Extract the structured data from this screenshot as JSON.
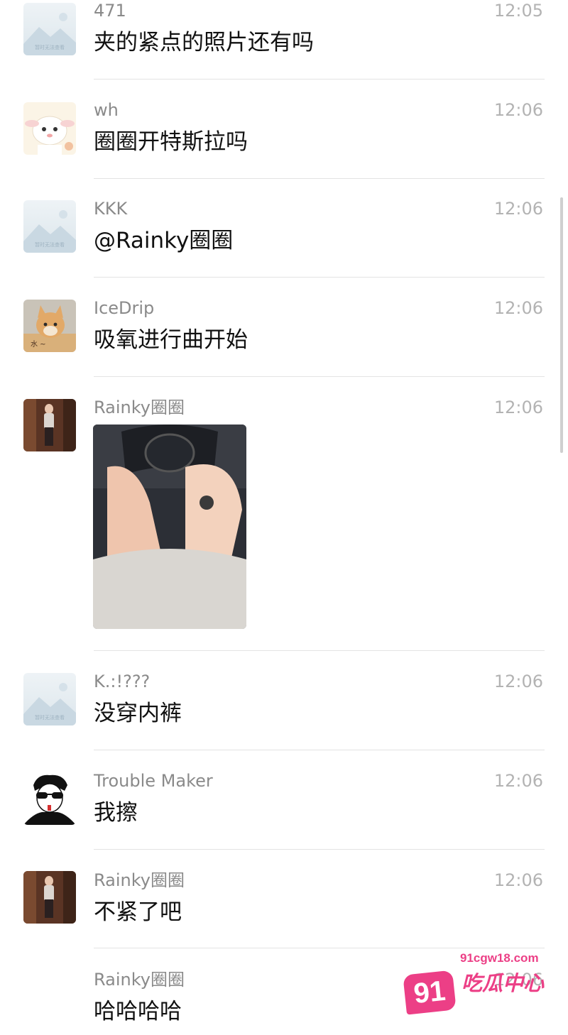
{
  "messages": [
    {
      "sender": "471",
      "time": "12:05",
      "text": "夹的紧点的照片还有吗",
      "avatar": "placeholder-image-icon"
    },
    {
      "sender": "wh",
      "time": "12:06",
      "text": "圈圈开特斯拉吗",
      "avatar": "lamb-cartoon-avatar"
    },
    {
      "sender": "KKK",
      "time": "12:06",
      "text": "@Rainky圈圈",
      "avatar": "placeholder-image-icon"
    },
    {
      "sender": "IceDrip",
      "time": "12:06",
      "text": "吸氧进行曲开始",
      "avatar": "cat-photo-avatar"
    },
    {
      "sender": "Rainky圈圈",
      "time": "12:06",
      "text": "",
      "avatar": "person-photo-avatar",
      "attachment": "car-interior-photo"
    },
    {
      "sender": "K.:!???",
      "time": "12:06",
      "text": "没穿内裤",
      "avatar": "placeholder-image-icon"
    },
    {
      "sender": "Trouble Maker",
      "time": "12:06",
      "text": "我擦",
      "avatar": "sunglasses-sketch-avatar"
    },
    {
      "sender": "Rainky圈圈",
      "time": "12:06",
      "text": "不紧了吧",
      "avatar": "person-photo-avatar"
    },
    {
      "sender": "Rainky圈圈",
      "time": "12:06",
      "text": "哈哈哈哈",
      "avatar": ""
    }
  ],
  "placeholder_caption": "暂时无法查看",
  "watermark": {
    "number": "91",
    "url": "91cgw18.com",
    "name": "吃瓜中心"
  },
  "colors": {
    "sender": "#8a8a8a",
    "time": "#b3b3b3",
    "text": "#111111",
    "divider": "#e3e3e3",
    "watermark": "#ec3f86"
  }
}
